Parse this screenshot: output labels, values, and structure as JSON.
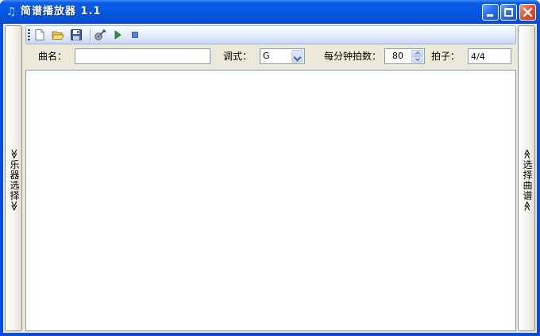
{
  "window": {
    "title": "简谱播放器 1.1",
    "app_icon": "music-note-icon",
    "controls": [
      "minimize-icon",
      "maximize-icon",
      "close-icon"
    ]
  },
  "toolbar": {
    "items": [
      {
        "name": "new-file",
        "icon": "new-document-icon"
      },
      {
        "name": "open-file",
        "icon": "open-folder-icon"
      },
      {
        "name": "save-file",
        "icon": "save-disk-icon"
      },
      {
        "name": "instrument",
        "icon": "guitar-icon"
      },
      {
        "name": "play",
        "icon": "play-icon"
      },
      {
        "name": "stop",
        "icon": "stop-icon"
      }
    ]
  },
  "settings": {
    "song_name_label": "曲名：",
    "song_name_value": "",
    "key_label": "调式：",
    "key_value": "G",
    "bpm_label": "每分钟拍数：",
    "bpm_value": "80",
    "time_sig_label": "拍子：",
    "time_sig_value": "4/4"
  },
  "side_panels": {
    "left_label": "≫乐器选择≫",
    "right_label": "≪选择曲谱≪"
  },
  "editor": {
    "content": ""
  },
  "colors": {
    "titlebar": "#0756e0",
    "client_bg": "#ece9d8",
    "toolbar_bg": "#e3ecfb",
    "field_border": "#7f9db9"
  }
}
